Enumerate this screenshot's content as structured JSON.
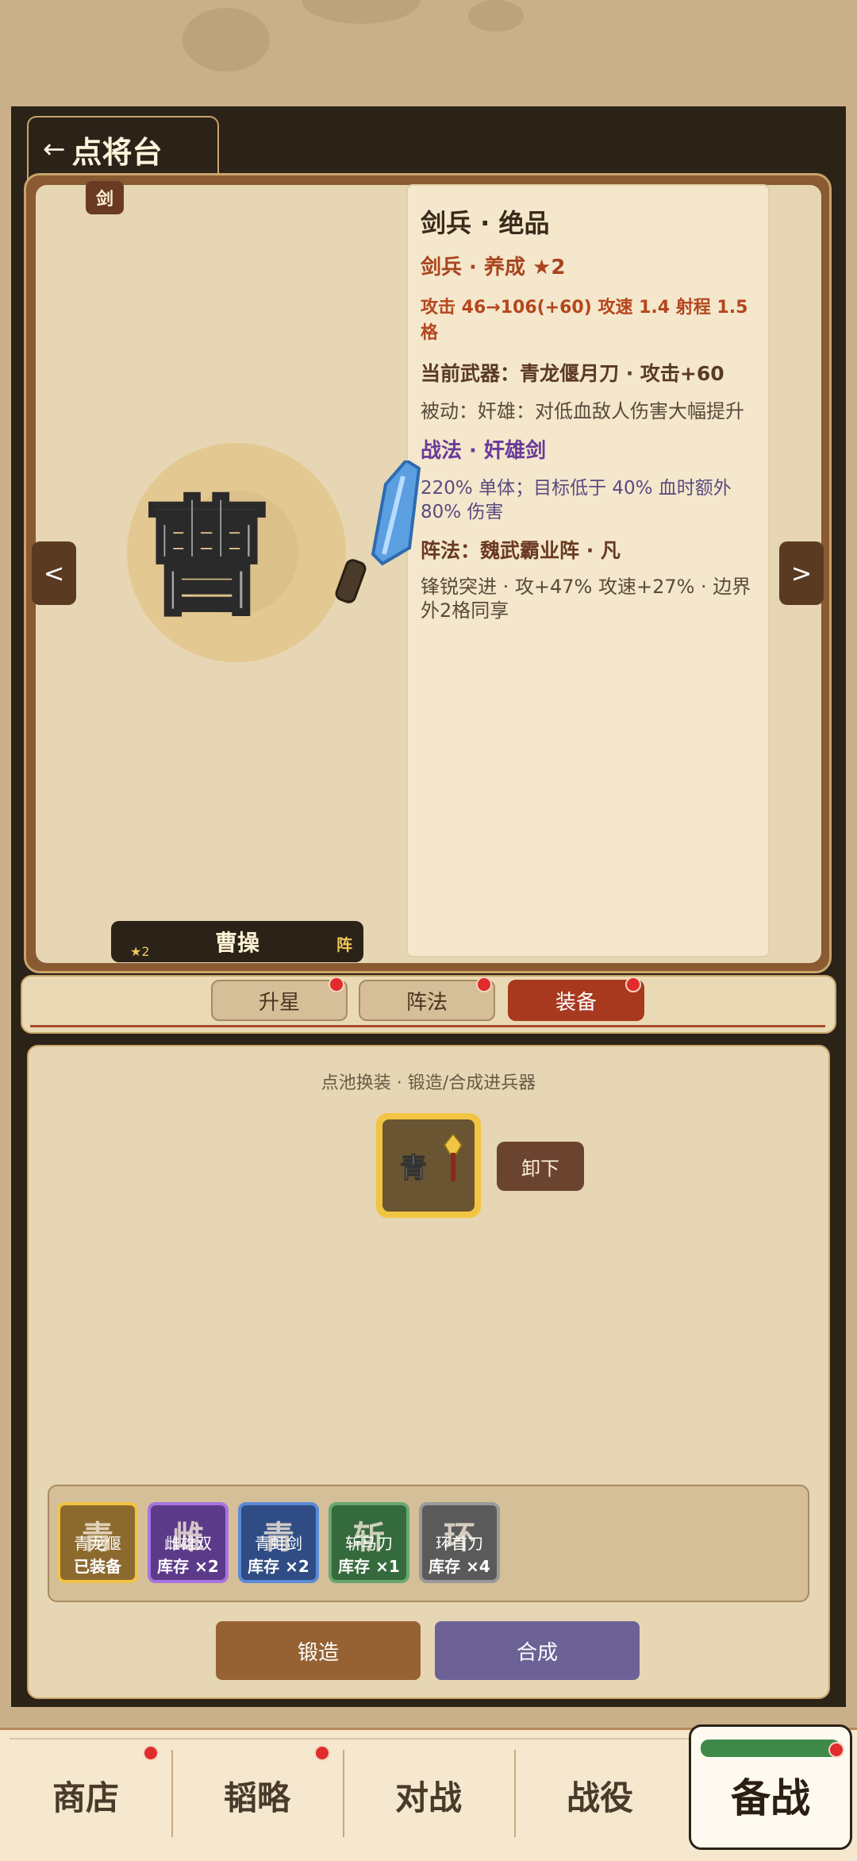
{
  "header": {
    "back_icon": "←",
    "title": "点将台"
  },
  "hero": {
    "type_badge": "剑",
    "portrait_char": "曹",
    "name": "曹操",
    "stars": "★2",
    "formation_badge": "阵",
    "nav_prev": "<",
    "nav_next": ">"
  },
  "info": {
    "title": "剑兵 · 绝品",
    "grade": "剑兵 · 养成 ★2",
    "stats": "攻击 46→106(+60)  攻速 1.4  射程 1.5 格",
    "weapon": "当前武器：青龙偃月刀 · 攻击+60",
    "passive": "被动：奸雄：对低血敌人伤害大幅提升",
    "skill_title": "战法 · 奸雄剑",
    "skill_desc": "220% 单体；目标低于 40% 血时额外 80% 伤害",
    "formation_title": "阵法：魏武霸业阵 · 凡",
    "formation_desc": "锋锐突进 · 攻+47% 攻速+27% · 边界外2格同享"
  },
  "tabs": [
    {
      "label": "升星",
      "active": false
    },
    {
      "label": "阵法",
      "active": false
    },
    {
      "label": "装备",
      "active": true
    }
  ],
  "equip": {
    "hint": "点池换装 · 锻造/合成进兵器",
    "slot_char": "青",
    "unequip_label": "卸下"
  },
  "inventory": [
    {
      "big": "青",
      "name": "青龙偃",
      "stock": "已装备",
      "color": "#8c6a2e",
      "border": "#f2c443"
    },
    {
      "big": "雌",
      "name": "雌雄双",
      "stock": "库存 ×2",
      "color": "#5c3a8a",
      "border": "#a873e0"
    },
    {
      "big": "青",
      "name": "青虹剑",
      "stock": "库存 ×2",
      "color": "#2f4c84",
      "border": "#5b8ad6"
    },
    {
      "big": "斩",
      "name": "斩马刀",
      "stock": "库存 ×1",
      "color": "#356a3c",
      "border": "#68a86e"
    },
    {
      "big": "环",
      "name": "环首刀",
      "stock": "库存 ×4",
      "color": "#5a5a5a",
      "border": "#9a9a9a"
    }
  ],
  "actions": {
    "forge": "锻造",
    "merge": "合成"
  },
  "bottom_nav": {
    "shop": "商店",
    "strategy": "韬略",
    "battle": "对战",
    "campaign": "战役",
    "prepare": "备战"
  },
  "colors": {
    "accent_red": "#a8381e",
    "panel": "#e6d6b3",
    "dark": "#2b2218",
    "notify_dot": "#e02c2c"
  }
}
